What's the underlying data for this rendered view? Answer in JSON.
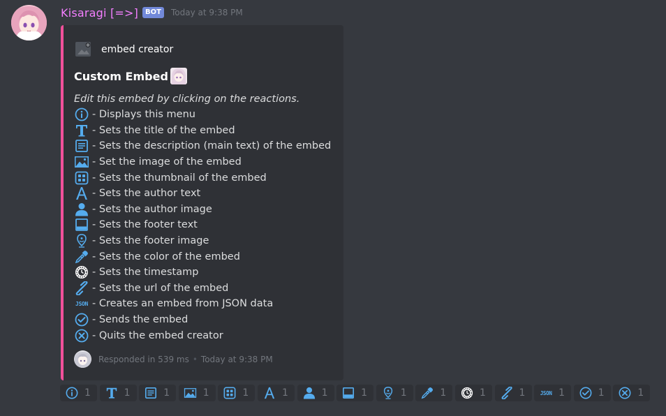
{
  "message": {
    "username": "Kisaragi [=>]",
    "bot_tag": "BOT",
    "timestamp": "Today at 9:38 PM",
    "username_color": "#f47fff",
    "bot_tag_color": "#7289da"
  },
  "embed": {
    "accent_color": "#f0509a",
    "author": {
      "name": "embed creator",
      "icon": "image-placeholder-icon"
    },
    "title": "Custom Embed",
    "intro": "Edit this embed by clicking on the reactions.",
    "lines": [
      {
        "icon": "info-icon",
        "text": " - Displays this menu"
      },
      {
        "icon": "title-t-icon",
        "text": " - Sets the title of the embed"
      },
      {
        "icon": "description-icon",
        "text": " - Sets the description (main text) of the embed"
      },
      {
        "icon": "image-icon",
        "text": " - Set the image of the embed"
      },
      {
        "icon": "thumbnail-grid-icon",
        "text": " - Sets the thumbnail of the embed"
      },
      {
        "icon": "author-a-icon",
        "text": " - Sets the author text"
      },
      {
        "icon": "person-icon",
        "text": " - Sets the author image"
      },
      {
        "icon": "footer-icon",
        "text": " - Sets the footer text"
      },
      {
        "icon": "location-pin-icon",
        "text": " - Sets the footer image"
      },
      {
        "icon": "eyedropper-icon",
        "text": " - Sets the color of the embed"
      },
      {
        "icon": "clock-icon",
        "text": " - Sets the timestamp"
      },
      {
        "icon": "link-icon",
        "text": " - Sets the url of the embed"
      },
      {
        "icon": "json-icon",
        "text": " - Creates an embed from JSON data"
      },
      {
        "icon": "check-circle-icon",
        "text": " - Sends the embed"
      },
      {
        "icon": "x-circle-icon",
        "text": " - Quits the embed creator"
      }
    ],
    "footer": {
      "text": "Responded in 539 ms",
      "separator": "•",
      "timestamp": "Today at 9:38 PM"
    },
    "json_label": "JSON"
  },
  "reactions": [
    {
      "icon": "info-icon",
      "count": "1"
    },
    {
      "icon": "title-t-icon",
      "count": "1"
    },
    {
      "icon": "description-icon",
      "count": "1"
    },
    {
      "icon": "image-icon",
      "count": "1"
    },
    {
      "icon": "thumbnail-grid-icon",
      "count": "1"
    },
    {
      "icon": "author-a-icon",
      "count": "1"
    },
    {
      "icon": "person-icon",
      "count": "1"
    },
    {
      "icon": "footer-icon",
      "count": "1"
    },
    {
      "icon": "location-pin-icon",
      "count": "1"
    },
    {
      "icon": "eyedropper-icon",
      "count": "1"
    },
    {
      "icon": "clock-icon",
      "count": "1"
    },
    {
      "icon": "link-icon",
      "count": "1"
    },
    {
      "icon": "json-icon",
      "count": "1"
    },
    {
      "icon": "check-circle-icon",
      "count": "1"
    },
    {
      "icon": "x-circle-icon",
      "count": "1"
    }
  ],
  "colors": {
    "background": "#36393f",
    "embed_bg": "#2f3136",
    "icon_blue": "#55acee",
    "muted": "#72767d"
  }
}
